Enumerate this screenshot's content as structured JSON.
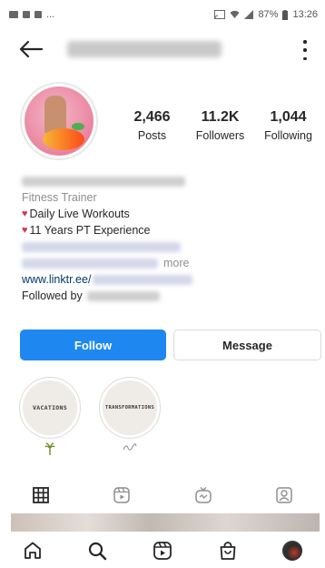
{
  "status_bar": {
    "left_icons": [
      "image-icon",
      "battery-saver-icon",
      "briefcase-icon"
    ],
    "left_more": "...",
    "battery": "87%",
    "time": "13:26"
  },
  "profile": {
    "stats": [
      {
        "value": "2,466",
        "label": "Posts"
      },
      {
        "value": "11.2K",
        "label": "Followers"
      },
      {
        "value": "1,044",
        "label": "Following"
      }
    ],
    "bio": {
      "category": "Fitness Trainer",
      "line1": "Daily Live Workouts",
      "line2": "11 Years PT Experience",
      "more": "more",
      "link": "www.linktr.ee/",
      "followed_by": "Followed by"
    }
  },
  "actions": {
    "follow": "Follow",
    "message": "Message"
  },
  "highlights": [
    {
      "title": "VACATIONS",
      "label_icon": "palm-tree-icon"
    },
    {
      "title": "TRANSFORMATIONS",
      "label_icon": "signature-icon"
    }
  ],
  "colors": {
    "follow_button": "#1e88f0",
    "link": "#00376b"
  }
}
